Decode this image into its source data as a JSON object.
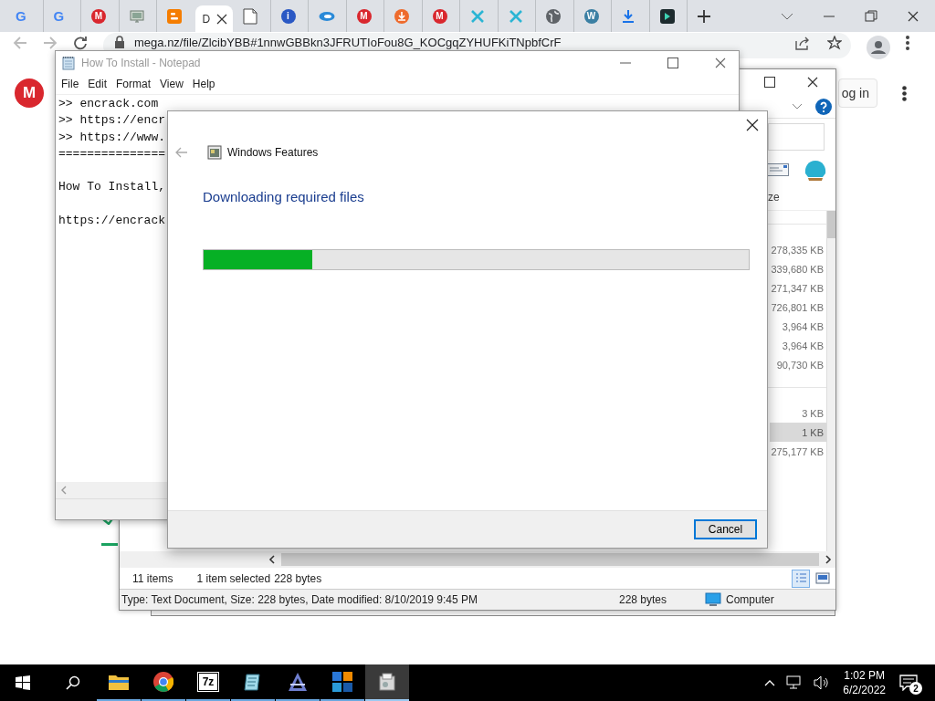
{
  "browser": {
    "tabs": [
      {
        "kind": "letter",
        "glyph": "G",
        "color": "#4285f4",
        "selected": false
      },
      {
        "kind": "letter",
        "glyph": "G",
        "color": "#4285f4",
        "selected": false
      },
      {
        "kind": "badge",
        "glyph": "M",
        "color": "#d9272e",
        "selected": false
      },
      {
        "kind": "monitor",
        "selected": false
      },
      {
        "kind": "blogger",
        "selected": false
      },
      {
        "kind": "none",
        "label": "D",
        "selected": true
      },
      {
        "kind": "page",
        "selected": false
      },
      {
        "kind": "badge",
        "glyph": "i",
        "color": "#2a58c4",
        "selected": false
      },
      {
        "kind": "swirl",
        "selected": false
      },
      {
        "kind": "badge",
        "glyph": "M",
        "color": "#d9272e",
        "selected": false
      },
      {
        "kind": "download-circle",
        "selected": false
      },
      {
        "kind": "badge",
        "glyph": "M",
        "color": "#d9272e",
        "selected": false
      },
      {
        "kind": "cross",
        "color": "#2bb5d4",
        "selected": false
      },
      {
        "kind": "cross",
        "color": "#2bb5d4",
        "selected": false
      },
      {
        "kind": "globe",
        "selected": false
      },
      {
        "kind": "badge",
        "glyph": "W",
        "color": "#3b7fa3",
        "selected": false
      },
      {
        "kind": "download",
        "selected": false
      },
      {
        "kind": "dark-app",
        "selected": false
      }
    ],
    "address": "mega.nz/file/ZlcibYBB#1nnwGBBkn3JFRUTIoFou8G_KOCgqZYHUFKiTNpbfCrF",
    "page": {
      "logo_glyph": "M",
      "login_button": "og in"
    }
  },
  "notepad": {
    "title": "How To Install - Notepad",
    "menu": [
      "File",
      "Edit",
      "Format",
      "View",
      "Help"
    ],
    "blocks": [
      [
        ">> encrack.com",
        ">> https://encr",
        ">> https://www.",
        "==============="
      ],
      [
        "How To Install,"
      ],
      [
        "https://encrack"
      ]
    ]
  },
  "explorer": {
    "size_header": "ze",
    "groups": [
      {
        "rows": [
          {
            "size": "278,335 KB",
            "selected": false
          },
          {
            "size": "339,680 KB",
            "selected": false
          },
          {
            "size": "271,347 KB",
            "selected": false
          },
          {
            "size": "726,801 KB",
            "selected": false
          },
          {
            "size": "3,964 KB",
            "selected": false
          },
          {
            "size": "3,964 KB",
            "selected": false
          },
          {
            "size": "90,730 KB",
            "selected": false
          }
        ]
      },
      {
        "rows": [
          {
            "size": "3 KB",
            "selected": false
          },
          {
            "size": "1 KB",
            "selected": true
          },
          {
            "size": "275,177 KB",
            "selected": false
          }
        ]
      }
    ],
    "item_count": "11 items",
    "selection": "1 item selected",
    "selection_size": "228 bytes",
    "views": [
      {
        "kind": "details",
        "selected": true
      },
      {
        "kind": "preview",
        "selected": false
      }
    ],
    "details": "Type: Text Document, Size: 228 bytes, Date modified: 8/10/2019 9:45 PM",
    "details_size": "228 bytes",
    "location": "Computer"
  },
  "dialog": {
    "title": "Windows Features",
    "heading": "Downloading required files",
    "progress": {
      "level": 0.2
    },
    "buttons": [
      "Cancel"
    ]
  },
  "taskbar": {
    "apps": [
      {
        "kind": "folder",
        "running": true,
        "selected": false
      },
      {
        "kind": "ring",
        "running": true,
        "selected": false
      },
      {
        "kind": "glyph",
        "glyph": "7z",
        "running": true,
        "selected": false
      },
      {
        "kind": "notepad",
        "running": true,
        "selected": false
      },
      {
        "kind": "triangle",
        "running": true,
        "selected": false
      },
      {
        "kind": "grid",
        "running": true,
        "selected": false
      },
      {
        "kind": "box",
        "running": true,
        "selected": true
      }
    ],
    "time": "1:02 PM",
    "date": "6/2/2022",
    "notifications": "2"
  }
}
